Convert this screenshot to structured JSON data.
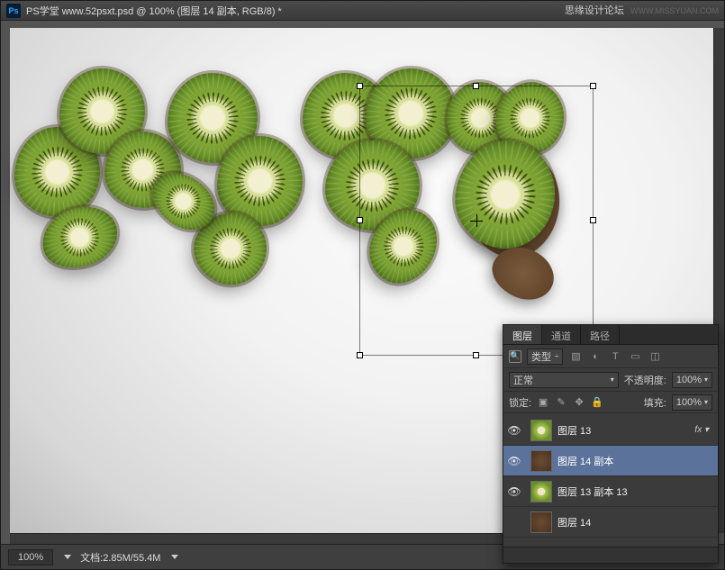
{
  "titlebar": {
    "app": "Ps",
    "title": "PS学堂   www.52psxt.psd @ 100% (图层 14 副本, RGB/8) *"
  },
  "watermark": {
    "main": "思缘设计论坛",
    "sub": "WWW.MISSYUAN.COM"
  },
  "status": {
    "zoom": "100%",
    "doc": "文档:2.85M/55.4M"
  },
  "panel": {
    "tabs": [
      "图层",
      "通道",
      "路径"
    ],
    "active_tab": 0,
    "filter_label": "类型",
    "blend": {
      "mode": "正常",
      "opacity_label": "不透明度:",
      "opacity": "100%"
    },
    "lock": {
      "label": "锁定:",
      "fill_label": "填充:",
      "fill": "100%"
    },
    "layers": [
      {
        "name": "图层 13",
        "fx": true,
        "selected": false,
        "thumb": "kiwi"
      },
      {
        "name": "图层 14 副本",
        "fx": false,
        "selected": true,
        "thumb": "skin"
      },
      {
        "name": "图层 13 副本 13",
        "fx": false,
        "selected": false,
        "thumb": "kiwi"
      },
      {
        "name": "图层 14",
        "fx": false,
        "selected": false,
        "thumb": "skin"
      }
    ]
  }
}
